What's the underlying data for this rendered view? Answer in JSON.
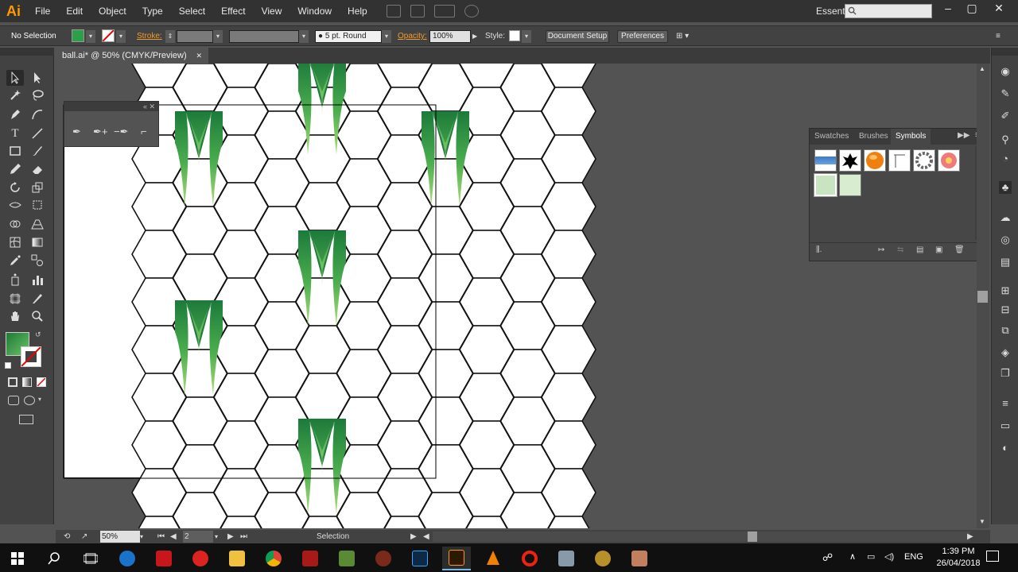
{
  "app": {
    "logo": "Ai",
    "accent": "#ff9a00"
  },
  "menu": [
    "File",
    "Edit",
    "Object",
    "Type",
    "Select",
    "Effect",
    "View",
    "Window",
    "Help"
  ],
  "workspace": "Essentials",
  "search": {
    "placeholder": ""
  },
  "window_controls": {
    "minimize": "–",
    "maximize": "▢",
    "close": "✕"
  },
  "control_bar": {
    "selection": "No Selection",
    "stroke_label": "Stroke:",
    "brush": "5 pt. Round",
    "opacity_label": "Opacity:",
    "opacity": "100%",
    "style_label": "Style:",
    "document_setup": "Document Setup",
    "preferences": "Preferences"
  },
  "document": {
    "tab_title": "ball.ai* @ 50% (CMYK/Preview)",
    "close": "✕"
  },
  "symbols_panel": {
    "tabs": [
      "Swatches",
      "Brushes",
      "Symbols"
    ],
    "active_tab": "Symbols",
    "symbols": [
      "blue-bar-symbol",
      "black-splash-symbol",
      "orange-ball-symbol",
      "pin-symbol",
      "ring-symbol",
      "pink-flower-symbol",
      "green-pattern-symbol",
      "green-pattern-2-symbol"
    ]
  },
  "status": {
    "zoom": "50%",
    "artboard_num": "2",
    "tool": "Selection"
  },
  "taskbar": {
    "lang": "ENG",
    "time": "1:39 PM",
    "date": "26/04/2018",
    "apps": [
      "windows-start",
      "search",
      "task-view",
      "edge",
      "acrobat",
      "chrome-like",
      "file-explorer",
      "chrome",
      "dota2",
      "minecraft",
      "game",
      "photoshop",
      "illustrator",
      "vlc",
      "opera",
      "app-ship",
      "app-gold",
      "app-photo"
    ]
  },
  "colors": {
    "fill": "#2e9e4a",
    "stroke_none": "#ff0000",
    "accent_label": "#f29b2f"
  }
}
